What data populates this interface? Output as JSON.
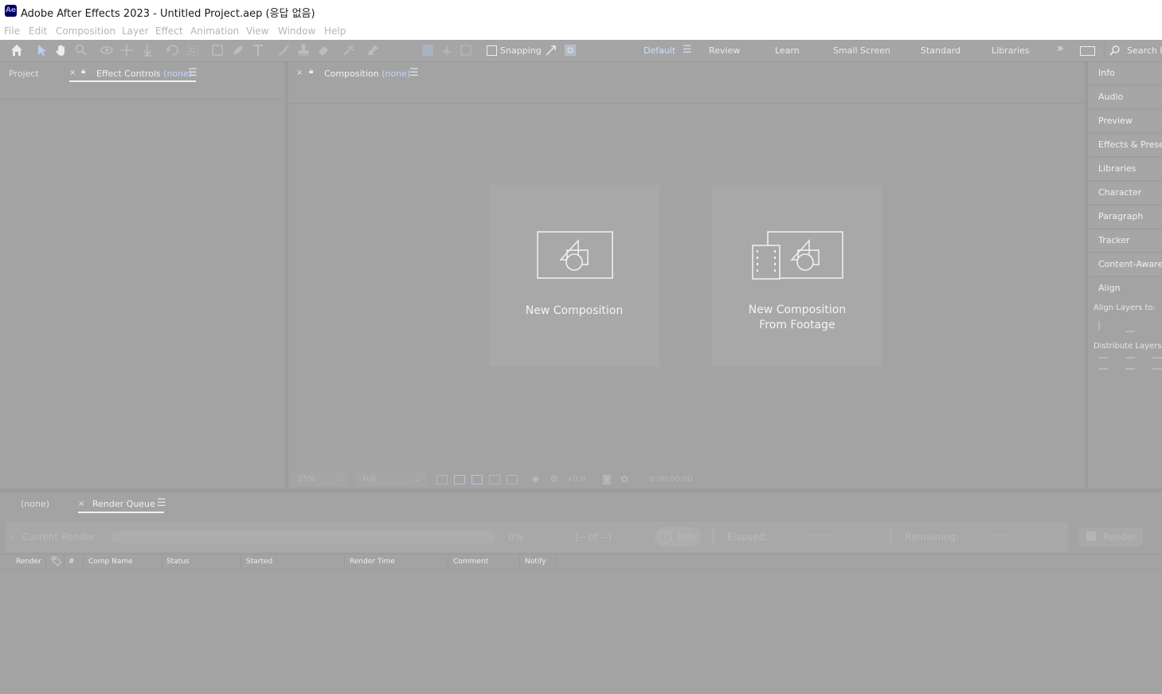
{
  "window": {
    "app_badge": "Ae",
    "title": "Adobe After Effects 2023 - Untitled Project.aep (응답 없음)"
  },
  "menu": [
    "File",
    "Edit",
    "Composition",
    "Layer",
    "Effect",
    "Animation",
    "View",
    "Window",
    "Help"
  ],
  "toolbar": {
    "snapping_label": "Snapping",
    "workspaces": [
      "Default",
      "Review",
      "Learn",
      "Small Screen",
      "Standard",
      "Libraries"
    ],
    "search_label": "Search H"
  },
  "left_panel": {
    "tab_project": "Project",
    "tab_effect_controls": "Effect Controls",
    "effect_controls_suffix": "(none)"
  },
  "composition_panel": {
    "tab_label": "Composition",
    "tab_suffix": "(none)",
    "new_composition": "New Composition",
    "new_from_footage_line1": "New Composition",
    "new_from_footage_line2": "From Footage",
    "zoom": "25%",
    "resolution": "Full",
    "exposure": "+0.0",
    "timecode": "0:00:00:00"
  },
  "right_panel": {
    "items": [
      "Info",
      "Audio",
      "Preview",
      "Effects & Presets",
      "Libraries",
      "Character",
      "Paragraph",
      "Tracker",
      "Content-Aware F",
      "Align"
    ],
    "align_layers_to": "Align Layers to:",
    "distribute_layers": "Distribute Layers"
  },
  "bottom_panel": {
    "tab_none": "(none)",
    "tab_render_queue": "Render Queue",
    "current_render": "Current Render",
    "progress": "0%",
    "of_label": "(-- of --)",
    "info_button": "Info",
    "elapsed_label": "Elapsed:",
    "elapsed_value": "--:--:--",
    "remaining_label": "Remaining:",
    "remaining_value": "--:--:--",
    "render_button": "Render",
    "columns": [
      "Render",
      "#",
      "Comp Name",
      "Status",
      "Started",
      "Render Time",
      "Comment",
      "Notify"
    ]
  }
}
